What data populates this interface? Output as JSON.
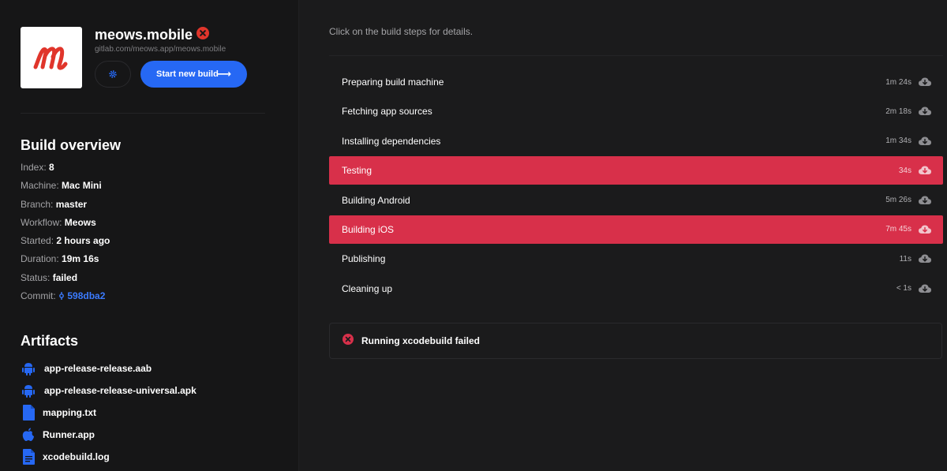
{
  "app": {
    "name": "meows.mobile",
    "repo": "gitlab.com/meows.app/meows.mobile",
    "logo_letter": "m",
    "brand_color": "#e0352b",
    "start_build_label": "Start new build",
    "settings_icon": "gear-icon"
  },
  "overview": {
    "title": "Build overview",
    "rows": [
      {
        "label": "Index:",
        "value": "8"
      },
      {
        "label": "Machine:",
        "value": "Mac Mini"
      },
      {
        "label": "Branch:",
        "value": "master"
      },
      {
        "label": "Workflow:",
        "value": "Meows"
      },
      {
        "label": "Started:",
        "value": "2 hours ago"
      },
      {
        "label": "Duration:",
        "value": "19m 16s"
      },
      {
        "label": "Status:",
        "value": "failed"
      },
      {
        "label": "Commit:",
        "value": "598dba2"
      }
    ]
  },
  "artifacts": {
    "title": "Artifacts",
    "items": [
      {
        "name": "app-release-release.aab",
        "icon": "android-icon"
      },
      {
        "name": "app-release-release-universal.apk",
        "icon": "android-icon"
      },
      {
        "name": "mapping.txt",
        "icon": "file-icon"
      },
      {
        "name": "Runner.app",
        "icon": "apple-icon"
      },
      {
        "name": "xcodebuild.log",
        "icon": "log-file-icon"
      }
    ]
  },
  "main": {
    "hint": "Click on the build steps for details.",
    "steps": [
      {
        "label": "Preparing build machine",
        "duration": "1m 24s",
        "status": "ok"
      },
      {
        "label": "Fetching app sources",
        "duration": "2m 18s",
        "status": "ok"
      },
      {
        "label": "Installing dependencies",
        "duration": "1m 34s",
        "status": "ok"
      },
      {
        "label": "Testing",
        "duration": "34s",
        "status": "failed"
      },
      {
        "label": "Building Android",
        "duration": "5m 26s",
        "status": "ok"
      },
      {
        "label": "Building iOS",
        "duration": "7m 45s",
        "status": "failed"
      },
      {
        "label": "Publishing",
        "duration": "11s",
        "status": "ok"
      },
      {
        "label": "Cleaning up",
        "duration": "< 1s",
        "status": "ok"
      }
    ],
    "error_message": "Running xcodebuild failed"
  },
  "colors": {
    "accent": "#2668f4",
    "failed": "#d8304a",
    "background": "#1b1b1c",
    "sidebar": "#161617"
  }
}
